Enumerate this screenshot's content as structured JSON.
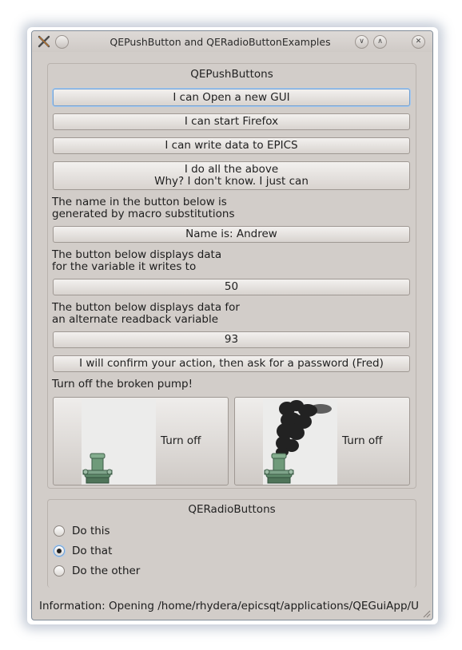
{
  "window": {
    "title": "QEPushButton and QERadioButtonExamples"
  },
  "push_group": {
    "title": "QEPushButtons",
    "buttons": {
      "open_gui": "I can Open a new GUI",
      "start_firefox": "I can start Firefox",
      "write_epics": "I can write data to EPICS",
      "all_line1": "I do all the above",
      "all_line2": "Why? I don't know. I just can",
      "name": "Name is: Andrew",
      "value1": "50",
      "value2": "93",
      "confirm": "I will confirm your action, then ask for a password (Fred)"
    },
    "labels": {
      "macro_line1": "The name in the button below is",
      "macro_line2": "generated by macro substitutions",
      "var_line1": "The button below displays data",
      "var_line2": "for the variable it writes to",
      "alt_line1": "The button below displays data for",
      "alt_line2": "an alternate readback variable",
      "pump": "Turn off the broken pump!"
    },
    "pump_buttons": [
      {
        "label": "Turn off",
        "image": "pump-icon"
      },
      {
        "label": "Turn off",
        "image": "smoking-pump-icon"
      }
    ]
  },
  "radio_group": {
    "title": "QERadioButtons",
    "options": [
      {
        "label": "Do this",
        "selected": false
      },
      {
        "label": "Do that",
        "selected": true
      },
      {
        "label": "Do the other",
        "selected": false
      }
    ]
  },
  "status_bar": {
    "text": "Information: Opening /home/rhydera/epicsqt/applications/QEGuiApp/UISa"
  },
  "colors": {
    "window_bg": "#d2cdc9",
    "focus_accent": "#6f9fd3",
    "pump_green": "#6f9a7a",
    "smoke": "#111111"
  }
}
